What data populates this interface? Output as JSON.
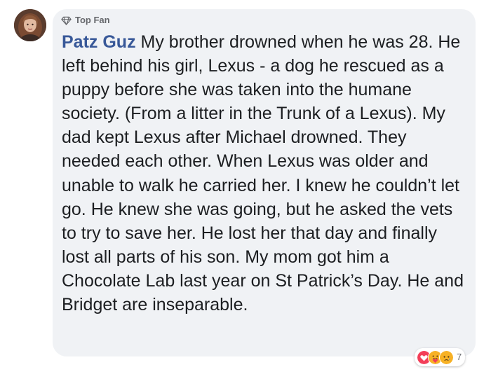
{
  "comment": {
    "badge": {
      "label": "Top Fan",
      "icon": "diamond-icon"
    },
    "author": "Patz Guz",
    "text": " My brother drowned when he was 28. He left behind his girl, Lexus - a dog he rescued as a puppy before she was taken into the humane society. (From a litter in the Trunk of a Lexus). My dad kept Lexus after Michael drowned. They needed each other. When Lexus was older and unable to walk he carried her. I knew he couldn’t let go. He knew she was going, but he asked the vets to try to save her. He lost her that day and finally lost all parts of his son. My mom got him a Chocolate Lab last year on St Patrick’s Day. He and Bridget are inseparable.",
    "reactions": {
      "icons": [
        "love-icon",
        "care-icon",
        "sad-icon"
      ],
      "count": "7"
    }
  },
  "colors": {
    "bubble_bg": "#f0f2f5",
    "author": "#385898",
    "text": "#1c1e21",
    "meta": "#65676b",
    "love": "#f33e58",
    "care": "#f7b125",
    "sad": "#f7b125"
  }
}
